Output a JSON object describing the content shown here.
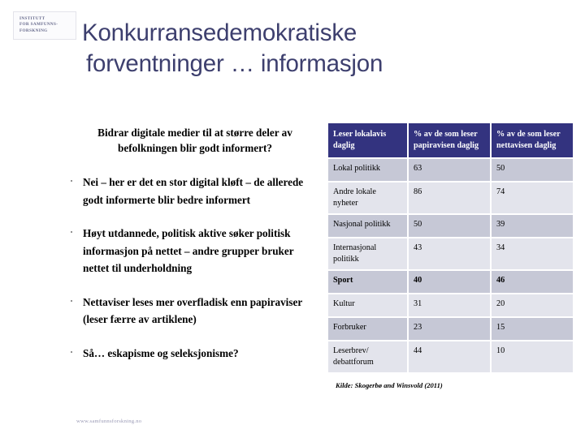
{
  "slide": {
    "logo": {
      "lines": [
        "INSTITUTT",
        "FOR SAMFUNNS-",
        "FORSKNING"
      ]
    },
    "title": {
      "line1": "Konkurransedemokratiske",
      "line2": "forventninger … informasjon"
    },
    "content": {
      "question": "Bidrar digitale medier til at større deler av befolkningen blir godt informert?",
      "bullets": [
        "Nei – her er det en stor digital kløft – de allerede godt informerte blir bedre informert",
        "Høyt utdannede, politisk aktive søker politisk informasjon på nettet – andre grupper bruker nettet til underholdning",
        "Nettaviser leses mer overfladisk enn papiraviser (leser færre av artiklene)",
        "Så… eskapisme og seleksjonisme?"
      ]
    },
    "table": {
      "headers": [
        "Leser lokalavis daglig",
        "% av de som leser papiravisen daglig",
        "% av de som leser nettavisen daglig"
      ],
      "rows": [
        {
          "label": "Lokal politikk",
          "paper": "63",
          "net": "50",
          "emphasis": false
        },
        {
          "label": "Andre lokale nyheter",
          "paper": "86",
          "net": "74",
          "emphasis": false
        },
        {
          "label": "Nasjonal politikk",
          "paper": "50",
          "net": "39",
          "emphasis": false
        },
        {
          "label": "Internasjonal politikk",
          "paper": "43",
          "net": "34",
          "emphasis": false
        },
        {
          "label": "Sport",
          "paper": "40",
          "net": "46",
          "emphasis": true
        },
        {
          "label": "Kultur",
          "paper": "31",
          "net": "20",
          "emphasis": false
        },
        {
          "label": "Forbruker",
          "paper": "23",
          "net": "15",
          "emphasis": false
        },
        {
          "label": "Leserbrev/ debattforum",
          "paper": "44",
          "net": "10",
          "emphasis": false
        }
      ],
      "source_note": "Kilde: Skogerbø and Winsvold (2011)"
    },
    "footer": {
      "url": "www.samfunnsforskning.no"
    },
    "colors": {
      "title_navy": "#3d3f6e",
      "table_header_navy": "#33337f",
      "row_dark": "#c6c8d6",
      "row_light": "#e3e4ec",
      "footer_gray": "#9a9ab5"
    }
  }
}
